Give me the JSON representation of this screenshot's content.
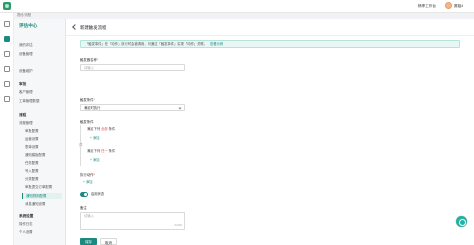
{
  "breadcrumb": "赛优/流程",
  "header": {
    "workspace": "畅享工作台",
    "user": "赛姐4"
  },
  "sidebar": {
    "title": "评估中心",
    "group1": [
      "我的评估",
      "设备管理",
      "设备维护"
    ],
    "sec2": "审批",
    "group2": [
      "客户管理",
      "工单管理数据"
    ],
    "sec3": "流程",
    "group3_label": "流程管理",
    "sub_items": [
      "审批配置",
      "运营设置",
      "表单设置",
      "通知模板配置",
      "任务配置",
      "号入配置",
      "分类配置",
      "审批提交订单配置",
      "通知规则配置",
      "消息通知设置"
    ],
    "active_sub_index": 8,
    "sec4": "系统设置",
    "tail": [
      "操作日志",
      "个人设置"
    ]
  },
  "page": {
    "title": "新建触发流程",
    "notice": "「触发事件」在「动作」执行时会被调用，可通过「触发事件」实现「动作」关联。",
    "notice_link": "查看示例",
    "name_label": "触发器名称",
    "name_placeholder": "请输入",
    "event_label": "触发条件",
    "event_value": "满足时执行",
    "cond_label": "触发条件",
    "cond1_a": "满足下列",
    "cond1_hl": "全部",
    "cond1_b": "条件",
    "cond1_add": "添加",
    "or_text": "或",
    "cond2_a": "满足下列",
    "cond2_hl": "任一",
    "cond2_b": "条件",
    "cond2_add": "添加",
    "action_label": "执行动作",
    "action_add": "添加",
    "toggle_label": "启用状态",
    "remark_label": "备注",
    "remark_placeholder": "请输入",
    "remark_count": "0/200",
    "save": "保存",
    "cancel": "取消"
  }
}
